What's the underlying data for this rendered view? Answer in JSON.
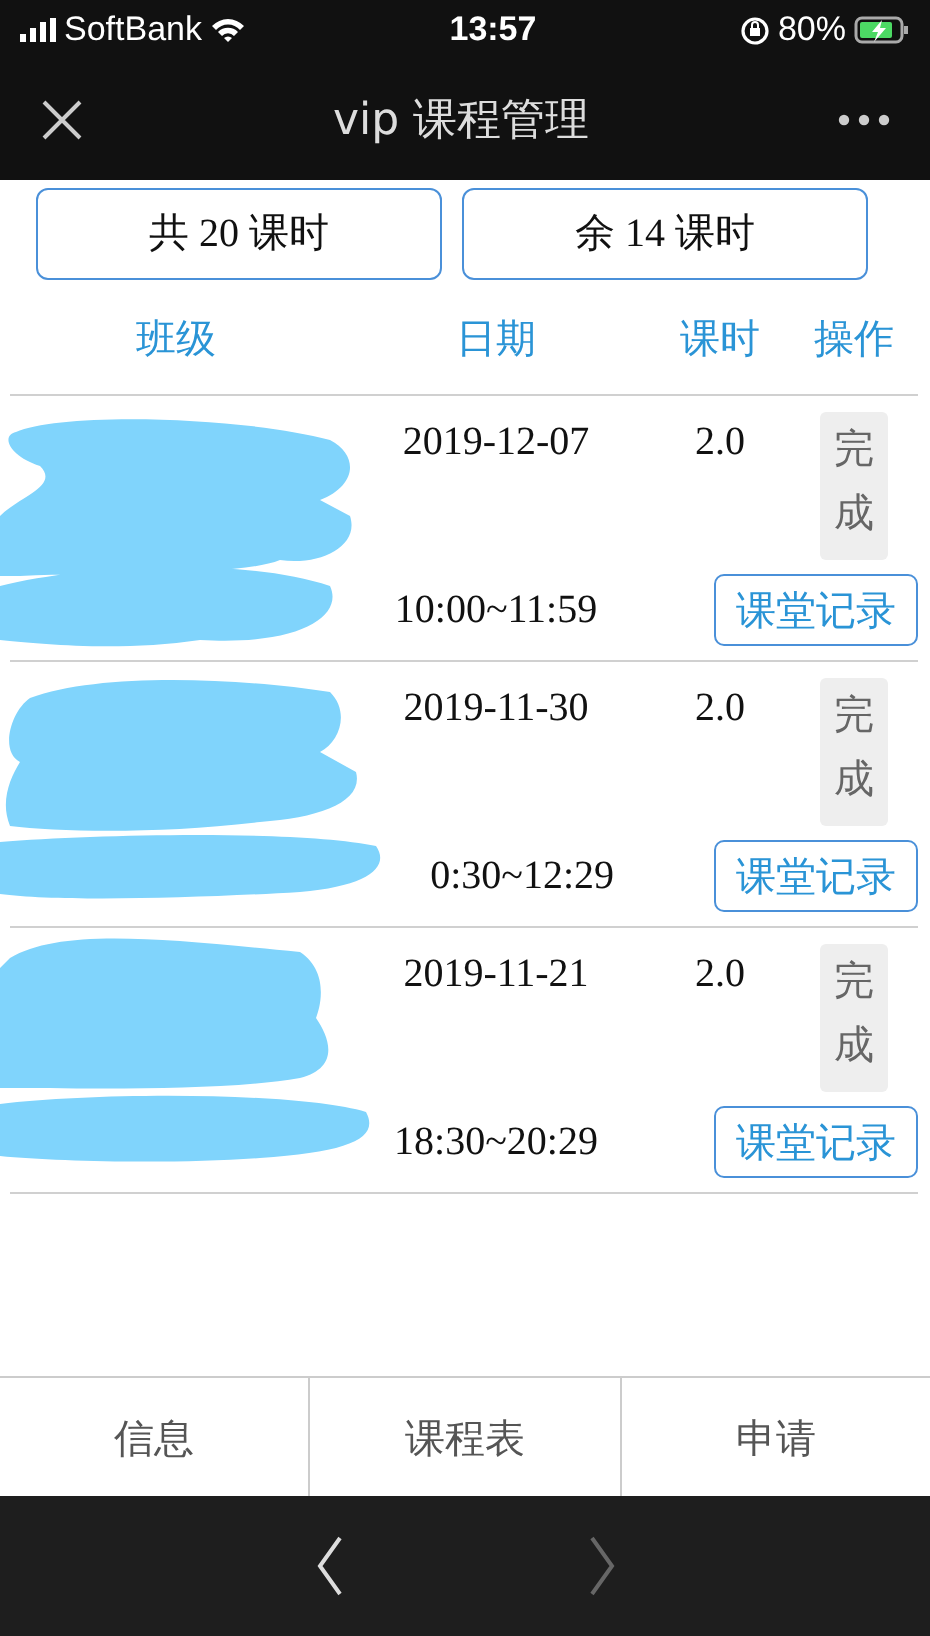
{
  "status_bar": {
    "carrier": "SoftBank",
    "time": "13:57",
    "battery": "80%"
  },
  "nav": {
    "title": "vip 课程管理"
  },
  "summary": [
    "共 20 课时",
    "余 14 课时"
  ],
  "columns": [
    "班级",
    "日期",
    "课时",
    "操作"
  ],
  "rows": [
    {
      "date": "2019-12-07",
      "time": "10:00~11:59",
      "hours": "2.0",
      "status": "完成",
      "action": "课堂记录"
    },
    {
      "date": "2019-11-30",
      "time": "0:30~12:29",
      "hours": "2.0",
      "status": "完成",
      "action": "课堂记录"
    },
    {
      "date": "2019-11-21",
      "time": "18:30~20:29",
      "hours": "2.0",
      "status": "完成",
      "action": "课堂记录"
    }
  ],
  "tabs": [
    {
      "label": "信息"
    },
    {
      "label": "课程表"
    },
    {
      "label": "申请"
    }
  ],
  "browser_nav": [
    {
      "kind": "back",
      "disabled": false
    },
    {
      "kind": "forward",
      "disabled": true
    }
  ]
}
